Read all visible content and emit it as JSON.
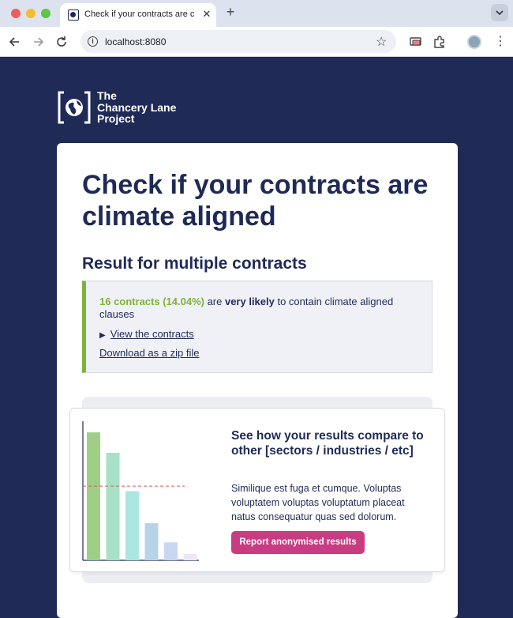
{
  "browser": {
    "tab_title": "Check if your contracts are climate aligned",
    "tab_close": "✕",
    "new_tab": "+",
    "url": "localhost:8080"
  },
  "logo": {
    "text": "The\nChancery Lane\nProject"
  },
  "page": {
    "headline": "Check if your contracts are climate aligned",
    "subheading": "Result for multiple contracts"
  },
  "result": {
    "count_text": "16 contracts (14.04%)",
    "pre_text": " are ",
    "likelihood": "very likely",
    "post_text": " to contain climate aligned clauses",
    "view_link": "View the contracts",
    "zip_link": "Download as a zip file"
  },
  "promo": {
    "title": "See how your results compare to other [sectors / industries / etc]",
    "body": "Similique est fuga et cumque. Voluptas voluptatem voluptas voluptatum placeat natus consequatur quas sed dolorum.",
    "button": "Report anonymised results"
  },
  "chart_data": {
    "type": "bar",
    "values": [
      100,
      84,
      54,
      29,
      14,
      5
    ],
    "reference_line": 58,
    "ylim": [
      0,
      105
    ],
    "colors": [
      "#9fcf86",
      "#a7e2c6",
      "#ace6e0",
      "#b7d3ea",
      "#c8d6ef",
      "#ece6f6"
    ],
    "reference_color": "#e05555"
  },
  "colors": {
    "navy": "#1f2a57",
    "accent_green": "#7fb23a",
    "button_pink": "#c83c82"
  }
}
